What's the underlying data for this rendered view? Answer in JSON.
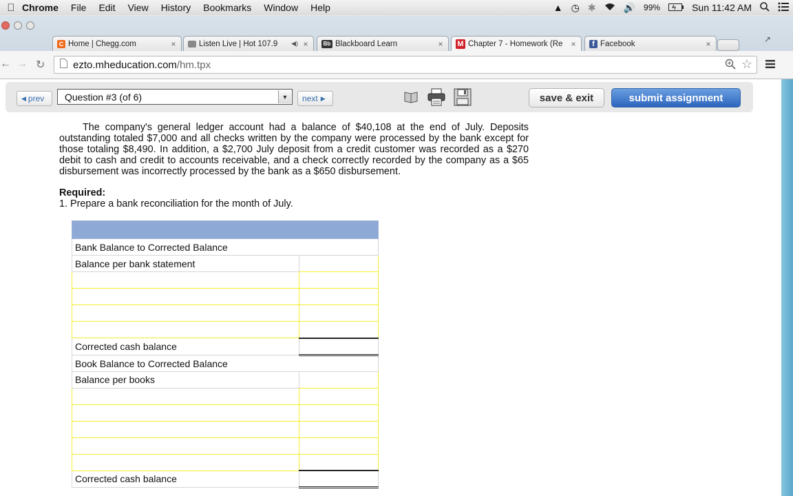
{
  "menubar": {
    "app": "Chrome",
    "items": [
      "File",
      "Edit",
      "View",
      "History",
      "Bookmarks",
      "Window",
      "Help"
    ],
    "battery": "99%",
    "clock": "Sun 11:42 AM"
  },
  "tabs": [
    {
      "title": "Home | Chegg.com",
      "favicon_text": "C",
      "favicon_color": "#f06a1c",
      "close": "×"
    },
    {
      "title": "Listen Live | Hot 107.9",
      "favicon_text": "",
      "favicon_color": "#888888",
      "close": "×",
      "audio": "◀)"
    },
    {
      "title": "Blackboard Learn",
      "favicon_text": "Bb",
      "favicon_color": "#333333",
      "close": "×"
    },
    {
      "title": "Chapter 7 - Homework (Re",
      "favicon_text": "M",
      "favicon_color": "#d0202a",
      "close": "×",
      "active": true
    },
    {
      "title": "Facebook",
      "favicon_text": "f",
      "favicon_color": "#3b5998",
      "close": "×"
    }
  ],
  "address": {
    "domain": "ezto.mheducation.com",
    "path": "/hm.tpx"
  },
  "question_bar": {
    "prev": "prev",
    "question": "Question #3 (of 6)",
    "next": "next",
    "save_exit": "save & exit",
    "submit": "submit assignment"
  },
  "problem": {
    "text": "The company's general ledger account had a balance of $40,108 at the end of July. Deposits outstanding totaled $7,000 and all checks written by the company were processed by the bank except for those totaling $8,490. In addition, a $2,700 July deposit from a credit customer was recorded as a $270 debit to cash and credit to accounts receivable, and a check correctly recorded by the company as a $65 disbursement was incorrectly processed by the bank as a $650 disbursement.",
    "required_heading": "Required:",
    "required_item": "1.  Prepare a bank reconciliation for the month of July."
  },
  "reconciliation": {
    "bank_section": "Bank Balance to Corrected Balance",
    "bank_start": "Balance per bank statement",
    "bank_total": "Corrected cash balance",
    "book_section": "Book Balance to Corrected Balance",
    "book_start": "Balance per books",
    "book_total": "Corrected cash balance"
  },
  "colors": {
    "table_header": "#8ea9d6",
    "input_border": "#f2ee2a",
    "submit_button": "#2d65be"
  }
}
